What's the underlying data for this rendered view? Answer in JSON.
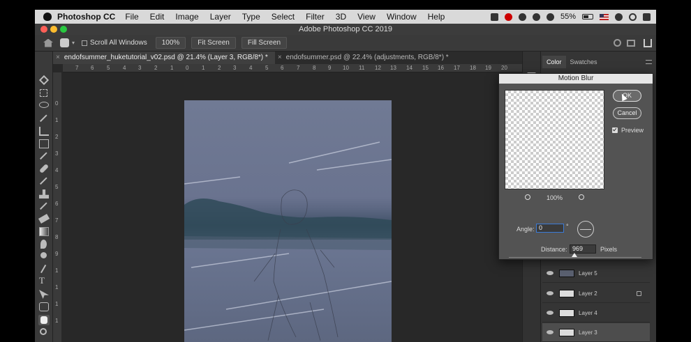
{
  "menubar": {
    "app": "Photoshop CC",
    "items": [
      "File",
      "Edit",
      "Image",
      "Layer",
      "Type",
      "Select",
      "Filter",
      "3D",
      "View",
      "Window",
      "Help"
    ],
    "battery": "55%"
  },
  "window": {
    "title": "Adobe Photoshop CC 2019"
  },
  "options": {
    "scroll_all": "Scroll All Windows",
    "zoom": "100%",
    "fit_screen": "Fit Screen",
    "fill_screen": "Fill Screen"
  },
  "tabs": [
    {
      "label": "endofsummer_huketutorial_v02.psd @ 21.4% (Layer 3, RGB/8*) *"
    },
    {
      "label": "endofsummer.psd @ 22.4% (adjustments, RGB/8*) *"
    }
  ],
  "ruler": {
    "h": [
      "7",
      "6",
      "5",
      "4",
      "3",
      "2",
      "1",
      "0",
      "1",
      "2",
      "3",
      "4",
      "5",
      "6",
      "7",
      "8",
      "9",
      "10",
      "11",
      "12",
      "13",
      "14",
      "15",
      "16",
      "17",
      "18",
      "19",
      "20"
    ],
    "v": [
      "0",
      "1",
      "2",
      "3",
      "4",
      "5",
      "6",
      "7",
      "8",
      "9",
      "1",
      "1",
      "1",
      "1"
    ]
  },
  "panel": {
    "tabs": [
      "Color",
      "Swatches"
    ],
    "layers": [
      {
        "name": "Layer 5"
      },
      {
        "name": "Layer 2"
      },
      {
        "name": "Layer 4"
      },
      {
        "name": "Layer 3"
      }
    ]
  },
  "dialog": {
    "title": "Motion Blur",
    "ok": "OK",
    "cancel": "Cancel",
    "preview": "Preview",
    "zoom": "100%",
    "angle_label": "Angle:",
    "angle_value": "0",
    "degree": "°",
    "distance_label": "Distance:",
    "distance_value": "969",
    "distance_unit": "Pixels"
  }
}
